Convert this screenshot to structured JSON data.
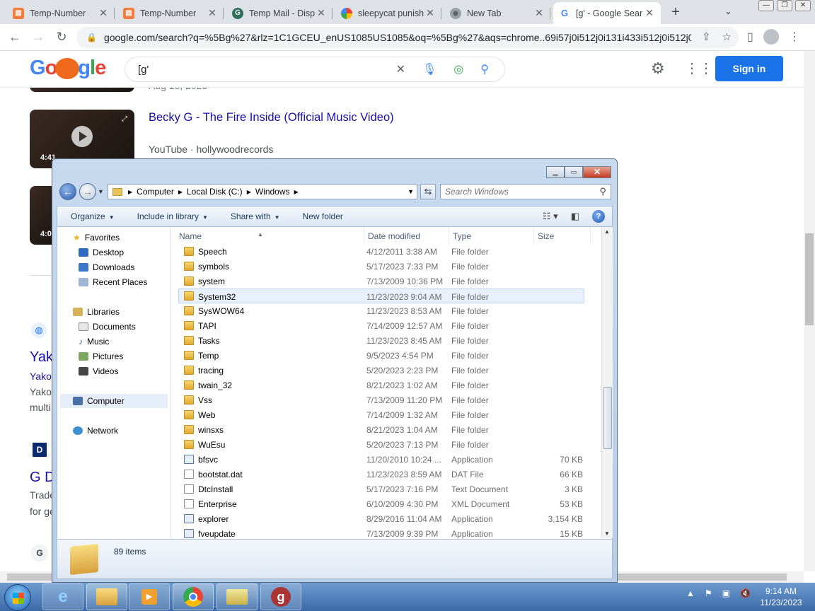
{
  "browser": {
    "tabs": [
      {
        "label": "Temp-Number",
        "icon": "temp-number-favicon",
        "active": false
      },
      {
        "label": "Temp-Number",
        "icon": "temp-number-favicon",
        "active": false
      },
      {
        "label": "Temp Mail - Disp",
        "icon": "tempmail-favicon",
        "active": false
      },
      {
        "label": "sleepycat punish",
        "icon": "google-favicon",
        "active": false
      },
      {
        "label": "New Tab",
        "icon": "chrome-favicon",
        "active": false
      },
      {
        "label": "[g' - Google Sear",
        "icon": "google-favicon",
        "active": true
      }
    ],
    "new_tab_symbol": "+",
    "url": "google.com/search?q=%5Bg%27&rlz=1C1GCEU_enUS1085US1085&oq=%5Bg%27&aqs=chrome..69i57j0i512j0i131i433i512j0i512j0i..."
  },
  "google": {
    "query": "[g'",
    "signin_label": "Sign in",
    "result": {
      "date": "Aug 18, 2023",
      "title": "Becky G - The Fire Inside (Official Music Video)",
      "source": "YouTube · hollywoodrecords",
      "duration": "4:41"
    },
    "peek": {
      "dur2": "4:0",
      "yak_big": "Yak",
      "yak_line1": "Yako",
      "yak_line2": "Yako",
      "yak_line3": "multi",
      "gd_big": "G D",
      "gd_line1": "Trade",
      "gd_line2": "for ge",
      "g_letter": "G"
    }
  },
  "explorer": {
    "breadcrumbs": [
      "Computer",
      "Local Disk (C:)",
      "Windows"
    ],
    "search_placeholder": "Search Windows",
    "commands": [
      "Organize",
      "Include in library",
      "Share with",
      "New folder"
    ],
    "nav": {
      "favorites": "Favorites",
      "favorites_items": [
        "Desktop",
        "Downloads",
        "Recent Places"
      ],
      "libraries": "Libraries",
      "libraries_items": [
        "Documents",
        "Music",
        "Pictures",
        "Videos"
      ],
      "computer": "Computer",
      "network": "Network"
    },
    "columns": {
      "name": "Name",
      "date": "Date modified",
      "type": "Type",
      "size": "Size"
    },
    "files": [
      {
        "name": "Speech",
        "date": "4/12/2011 3:38 AM",
        "type": "File folder",
        "size": "",
        "kind": "folder"
      },
      {
        "name": "symbols",
        "date": "5/17/2023 7:33 PM",
        "type": "File folder",
        "size": "",
        "kind": "folder"
      },
      {
        "name": "system",
        "date": "7/13/2009 10:36 PM",
        "type": "File folder",
        "size": "",
        "kind": "folder"
      },
      {
        "name": "System32",
        "date": "11/23/2023 9:04 AM",
        "type": "File folder",
        "size": "",
        "kind": "folder"
      },
      {
        "name": "SysWOW64",
        "date": "11/23/2023 8:53 AM",
        "type": "File folder",
        "size": "",
        "kind": "folder"
      },
      {
        "name": "TAPI",
        "date": "7/14/2009 12:57 AM",
        "type": "File folder",
        "size": "",
        "kind": "folder"
      },
      {
        "name": "Tasks",
        "date": "11/23/2023 8:45 AM",
        "type": "File folder",
        "size": "",
        "kind": "folder"
      },
      {
        "name": "Temp",
        "date": "9/5/2023 4:54 PM",
        "type": "File folder",
        "size": "",
        "kind": "folder"
      },
      {
        "name": "tracing",
        "date": "5/20/2023 2:23 PM",
        "type": "File folder",
        "size": "",
        "kind": "folder"
      },
      {
        "name": "twain_32",
        "date": "8/21/2023 1:02 AM",
        "type": "File folder",
        "size": "",
        "kind": "folder"
      },
      {
        "name": "Vss",
        "date": "7/13/2009 11:20 PM",
        "type": "File folder",
        "size": "",
        "kind": "folder"
      },
      {
        "name": "Web",
        "date": "7/14/2009 1:32 AM",
        "type": "File folder",
        "size": "",
        "kind": "folder"
      },
      {
        "name": "winsxs",
        "date": "8/21/2023 1:04 AM",
        "type": "File folder",
        "size": "",
        "kind": "folder"
      },
      {
        "name": "WuEsu",
        "date": "5/20/2023 7:13 PM",
        "type": "File folder",
        "size": "",
        "kind": "folder"
      },
      {
        "name": "bfsvc",
        "date": "11/20/2010 10:24 ...",
        "type": "Application",
        "size": "70 KB",
        "kind": "app"
      },
      {
        "name": "bootstat.dat",
        "date": "11/23/2023 8:59 AM",
        "type": "DAT File",
        "size": "66 KB",
        "kind": "doc"
      },
      {
        "name": "DtcInstall",
        "date": "5/17/2023 7:16 PM",
        "type": "Text Document",
        "size": "3 KB",
        "kind": "doc"
      },
      {
        "name": "Enterprise",
        "date": "6/10/2009 4:30 PM",
        "type": "XML Document",
        "size": "53 KB",
        "kind": "doc"
      },
      {
        "name": "explorer",
        "date": "8/29/2016 11:04 AM",
        "type": "Application",
        "size": "3,154 KB",
        "kind": "app"
      },
      {
        "name": "fveupdate",
        "date": "7/13/2009 9:39 PM",
        "type": "Application",
        "size": "15 KB",
        "kind": "app"
      }
    ],
    "hovered_file": "System32",
    "item_count": "89 items"
  },
  "taskbar": {
    "time": "9:14 AM",
    "date": "11/23/2023"
  },
  "colors": {
    "google_blue": "#1a73e8",
    "link": "#1a0dab",
    "explorer_frame": "#c7daef",
    "taskbar": "#3b6aa8"
  }
}
